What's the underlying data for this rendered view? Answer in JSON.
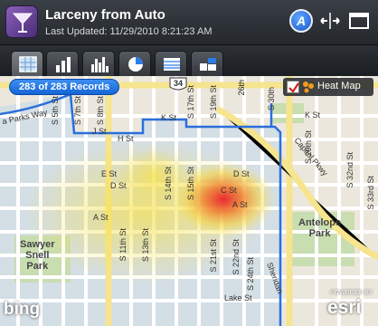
{
  "header": {
    "title": "Larceny from Auto",
    "last_updated": "Last Updated: 11/29/2010 8:21:23 AM",
    "a_button_label": "A"
  },
  "tabs": [
    {
      "name": "map-view",
      "icon": "map-grid-icon",
      "active": true
    },
    {
      "name": "bar-chart",
      "icon": "bar-chart-icon",
      "active": false
    },
    {
      "name": "column-chart",
      "icon": "column-chart-icon",
      "active": false
    },
    {
      "name": "pie-chart",
      "icon": "pie-chart-icon",
      "active": false
    },
    {
      "name": "table",
      "icon": "table-icon",
      "active": false
    },
    {
      "name": "layout",
      "icon": "layout-icon",
      "active": false
    }
  ],
  "map": {
    "records_text": "283 of 283 Records",
    "heatmap_label": "Heat Map",
    "heatmap_checked": true,
    "labels": {
      "hwy34": "34",
      "k_st_1": "K St",
      "k_st_2": "K St",
      "j_st": "J St",
      "h_st": "H St",
      "e_st": "E St",
      "d_st": "D St",
      "d_st_2": "D St",
      "c_st": "C St",
      "a_st": "A St",
      "a_st_2": "A St",
      "lake_st": "Lake St",
      "s_5th": "S 5th St",
      "s_7th": "S 7th St",
      "s_8th": "S 8th St",
      "s_11th": "S 11th St",
      "s_13th": "S 13th St",
      "s_14th": "S 14th St",
      "s_15th": "S 15th St",
      "s_17th": "S 17th St",
      "s_19th": "S 19th St",
      "s_21st": "S 21st St",
      "s_22nd": "S 22nd St",
      "s_24th": "S 24th St",
      "s_26th": "26th",
      "s_29th": "S 29th St",
      "s_30th": "S 30th",
      "s_32nd": "S 32nd St",
      "s_33rd": "S 33rd St",
      "capitol_pkwy": "Capitol Pkwy",
      "sheridan": "Sheridan",
      "parks_way": "a Parks Way",
      "sawyer_snell_park": "Sawyer\nSnell\nPark",
      "antelope_park": "Antelope\nPark",
      "bing": "bing",
      "powered_by": "POWERED BY",
      "esri": "esri"
    }
  },
  "colors": {
    "accent_blue": "#1565d6",
    "boundary_blue": "#2a6fdb",
    "park_green": "#c8ddb0",
    "road_yellow": "#f6e48f"
  }
}
